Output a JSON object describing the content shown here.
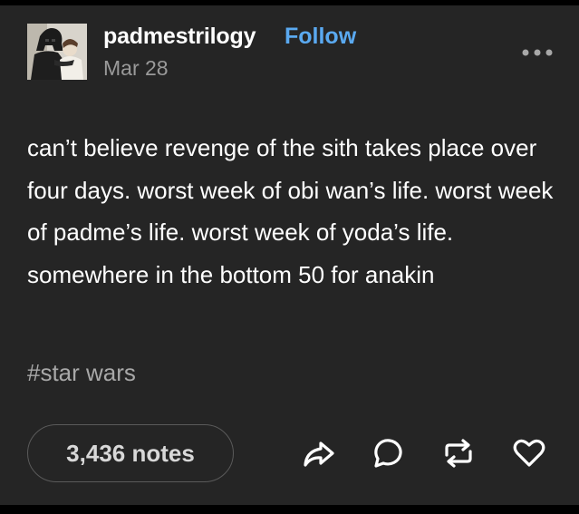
{
  "post": {
    "username": "padmestrilogy",
    "follow_label": "Follow",
    "date": "Mar 28",
    "body": "can’t believe revenge of the sith takes place over four days. worst week of obi wan’s life. worst week of padme’s life. worst week of yoda’s life. somewhere in the bottom 50 for anakin",
    "tag": "#star wars",
    "notes_label": "3,436 notes"
  },
  "actions": {
    "share_icon": "share-icon",
    "reply_icon": "reply-icon",
    "reblog_icon": "reblog-icon",
    "like_icon": "heart-icon",
    "more_icon": "more-icon"
  },
  "colors": {
    "background": "#252525",
    "follow": "#5aa9f0",
    "secondary_text": "#9a9a9a"
  }
}
